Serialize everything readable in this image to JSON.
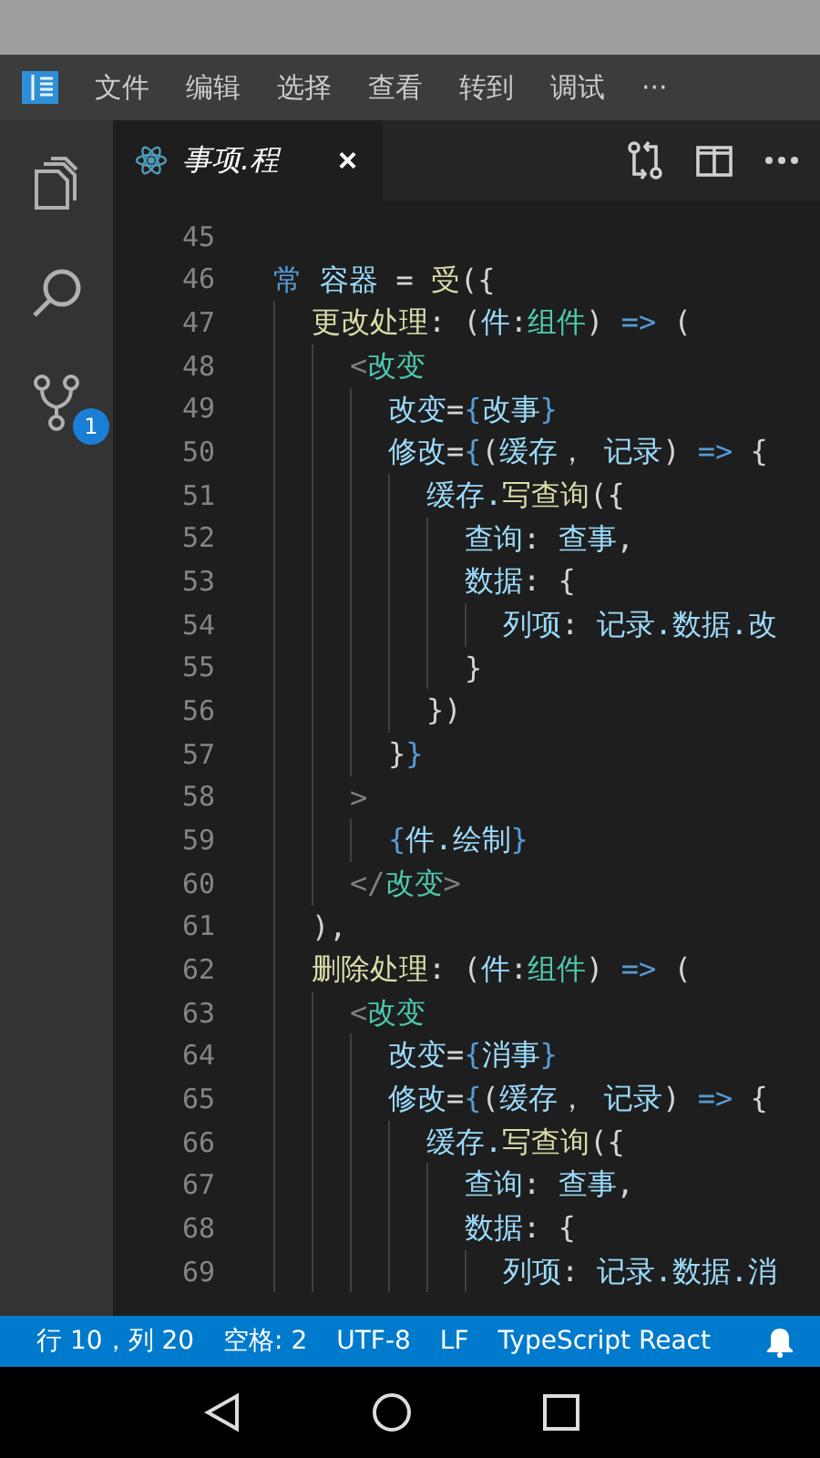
{
  "menu": [
    "文件",
    "编辑",
    "选择",
    "查看",
    "转到",
    "调试",
    "···"
  ],
  "activity": [
    {
      "kind": "files",
      "selected": false
    },
    {
      "kind": "search",
      "selected": false
    },
    {
      "kind": "scm",
      "selected": false,
      "badge": "1"
    }
  ],
  "tab": {
    "title": "事项.程",
    "close": "×"
  },
  "lines": [
    {
      "number": "45"
    },
    {
      "number": "46",
      "tokens": [
        {
          "text": "常",
          "kind": "keyword"
        },
        {
          "text": " 容器",
          "kind": "var"
        },
        {
          "text": " = ",
          "kind": "punct"
        },
        {
          "text": "受",
          "kind": "func"
        },
        {
          "text": "({",
          "kind": "punct"
        }
      ],
      "children": [
        {
          "number": "47",
          "tokens": [
            {
              "text": "更改处理",
              "kind": "func"
            },
            {
              "text": ": (",
              "kind": "punct"
            },
            {
              "text": "件",
              "kind": "var"
            },
            {
              "text": ":",
              "kind": "punct"
            },
            {
              "text": "组件",
              "kind": "type"
            },
            {
              "text": ") ",
              "kind": "punct"
            },
            {
              "text": "=>",
              "kind": "keyword"
            },
            {
              "text": " (",
              "kind": "punct"
            }
          ],
          "children": [
            {
              "number": "48",
              "tokens": [
                {
                  "text": "<",
                  "kind": "gray"
                },
                {
                  "text": "改变",
                  "kind": "type"
                }
              ],
              "children": [
                {
                  "number": "49",
                  "tokens": [
                    {
                      "text": "改变",
                      "kind": "var"
                    },
                    {
                      "text": "=",
                      "kind": "punct"
                    },
                    {
                      "text": "{",
                      "kind": "keyword"
                    },
                    {
                      "text": "改事",
                      "kind": "var"
                    },
                    {
                      "text": "}",
                      "kind": "keyword"
                    }
                  ]
                },
                {
                  "number": "50",
                  "tokens": [
                    {
                      "text": "修改",
                      "kind": "var"
                    },
                    {
                      "text": "=",
                      "kind": "punct"
                    },
                    {
                      "text": "{",
                      "kind": "keyword"
                    },
                    {
                      "text": "(",
                      "kind": "punct"
                    },
                    {
                      "text": "缓存",
                      "kind": "var"
                    },
                    {
                      "text": "， ",
                      "kind": "punct"
                    },
                    {
                      "text": "记录",
                      "kind": "var"
                    },
                    {
                      "text": ") ",
                      "kind": "punct"
                    },
                    {
                      "text": "=>",
                      "kind": "keyword"
                    },
                    {
                      "text": " {",
                      "kind": "punct"
                    }
                  ],
                  "children": [
                    {
                      "number": "51",
                      "tokens": [
                        {
                          "text": "缓存.",
                          "kind": "var"
                        },
                        {
                          "text": "写查询",
                          "kind": "func"
                        },
                        {
                          "text": "({",
                          "kind": "punct"
                        }
                      ],
                      "children": [
                        {
                          "number": "52",
                          "tokens": [
                            {
                              "text": "查询",
                              "kind": "var"
                            },
                            {
                              "text": ": ",
                              "kind": "punct"
                            },
                            {
                              "text": "查事",
                              "kind": "var"
                            },
                            {
                              "text": ",",
                              "kind": "punct"
                            }
                          ]
                        },
                        {
                          "number": "53",
                          "tokens": [
                            {
                              "text": "数据",
                              "kind": "var"
                            },
                            {
                              "text": ": {",
                              "kind": "punct"
                            }
                          ],
                          "children": [
                            {
                              "number": "54",
                              "tokens": [
                                {
                                  "text": "列项",
                                  "kind": "var"
                                },
                                {
                                  "text": ": ",
                                  "kind": "punct"
                                },
                                {
                                  "text": "记录.数据.改",
                                  "kind": "var"
                                }
                              ]
                            }
                          ]
                        },
                        {
                          "number": "55",
                          "tokens": [
                            {
                              "text": "}",
                              "kind": "punct"
                            }
                          ]
                        }
                      ]
                    },
                    {
                      "number": "56",
                      "tokens": [
                        {
                          "text": "})",
                          "kind": "punct"
                        }
                      ]
                    }
                  ]
                },
                {
                  "number": "57",
                  "tokens": [
                    {
                      "text": "}",
                      "kind": "punct"
                    },
                    {
                      "text": "}",
                      "kind": "keyword"
                    }
                  ]
                }
              ]
            },
            {
              "number": "58",
              "tokens": [
                {
                  "text": ">",
                  "kind": "gray"
                }
              ],
              "children": [
                {
                  "number": "59",
                  "tokens": [
                    {
                      "text": "{",
                      "kind": "keyword"
                    },
                    {
                      "text": "件.绘制",
                      "kind": "var"
                    },
                    {
                      "text": "}",
                      "kind": "keyword"
                    }
                  ]
                }
              ]
            },
            {
              "number": "60",
              "tokens": [
                {
                  "text": "</",
                  "kind": "gray"
                },
                {
                  "text": "改变",
                  "kind": "type"
                },
                {
                  "text": ">",
                  "kind": "gray"
                }
              ]
            }
          ]
        },
        {
          "number": "61",
          "tokens": [
            {
              "text": "),",
              "kind": "punct"
            }
          ]
        },
        {
          "number": "62",
          "tokens": [
            {
              "text": "删除处理",
              "kind": "func"
            },
            {
              "text": ": (",
              "kind": "punct"
            },
            {
              "text": "件",
              "kind": "var"
            },
            {
              "text": ":",
              "kind": "punct"
            },
            {
              "text": "组件",
              "kind": "type"
            },
            {
              "text": ") ",
              "kind": "punct"
            },
            {
              "text": "=>",
              "kind": "keyword"
            },
            {
              "text": " (",
              "kind": "punct"
            }
          ],
          "children": [
            {
              "number": "63",
              "tokens": [
                {
                  "text": "<",
                  "kind": "gray"
                },
                {
                  "text": "改变",
                  "kind": "type"
                }
              ],
              "children": [
                {
                  "number": "64",
                  "tokens": [
                    {
                      "text": "改变",
                      "kind": "var"
                    },
                    {
                      "text": "=",
                      "kind": "punct"
                    },
                    {
                      "text": "{",
                      "kind": "keyword"
                    },
                    {
                      "text": "消事",
                      "kind": "var"
                    },
                    {
                      "text": "}",
                      "kind": "keyword"
                    }
                  ]
                },
                {
                  "number": "65",
                  "tokens": [
                    {
                      "text": "修改",
                      "kind": "var"
                    },
                    {
                      "text": "=",
                      "kind": "punct"
                    },
                    {
                      "text": "{",
                      "kind": "keyword"
                    },
                    {
                      "text": "(",
                      "kind": "punct"
                    },
                    {
                      "text": "缓存",
                      "kind": "var"
                    },
                    {
                      "text": "， ",
                      "kind": "punct"
                    },
                    {
                      "text": "记录",
                      "kind": "var"
                    },
                    {
                      "text": ") ",
                      "kind": "punct"
                    },
                    {
                      "text": "=>",
                      "kind": "keyword"
                    },
                    {
                      "text": " {",
                      "kind": "punct"
                    }
                  ],
                  "children": [
                    {
                      "number": "66",
                      "tokens": [
                        {
                          "text": "缓存.",
                          "kind": "var"
                        },
                        {
                          "text": "写查询",
                          "kind": "func"
                        },
                        {
                          "text": "({",
                          "kind": "punct"
                        }
                      ],
                      "children": [
                        {
                          "number": "67",
                          "tokens": [
                            {
                              "text": "查询",
                              "kind": "var"
                            },
                            {
                              "text": ": ",
                              "kind": "punct"
                            },
                            {
                              "text": "查事",
                              "kind": "var"
                            },
                            {
                              "text": ",",
                              "kind": "punct"
                            }
                          ]
                        },
                        {
                          "number": "68",
                          "tokens": [
                            {
                              "text": "数据",
                              "kind": "var"
                            },
                            {
                              "text": ": {",
                              "kind": "punct"
                            }
                          ],
                          "children": [
                            {
                              "number": "69",
                              "tokens": [
                                {
                                  "text": "列项",
                                  "kind": "var"
                                },
                                {
                                  "text": ": ",
                                  "kind": "punct"
                                },
                                {
                                  "text": "记录.数据.消",
                                  "kind": "var"
                                }
                              ]
                            }
                          ]
                        }
                      ]
                    }
                  ]
                }
              ]
            }
          ]
        }
      ]
    }
  ],
  "status_bar": [
    "行 10，列 20",
    "空格: 2",
    "UTF-8",
    "LF",
    "TypeScript React"
  ]
}
